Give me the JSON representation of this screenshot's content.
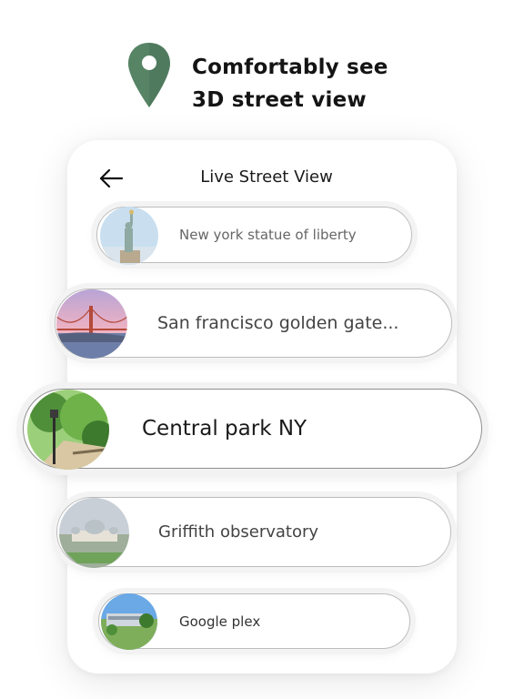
{
  "header": {
    "headline_line1": "Comfortably see",
    "headline_line2": "3D street view",
    "pin_icon": "location-pin-icon",
    "pin_color": "#4f7a5e"
  },
  "screen": {
    "title": "Live Street View",
    "back_icon": "arrow-left-icon"
  },
  "locations": [
    {
      "name": "New york statue of liberty",
      "thumb": "statue-of-liberty-image"
    },
    {
      "name": "San francisco golden gate...",
      "thumb": "golden-gate-bridge-image"
    },
    {
      "name": "Central park NY",
      "thumb": "central-park-image"
    },
    {
      "name": "Griffith observatory",
      "thumb": "griffith-observatory-image"
    },
    {
      "name": "Google plex",
      "thumb": "googleplex-image"
    }
  ]
}
